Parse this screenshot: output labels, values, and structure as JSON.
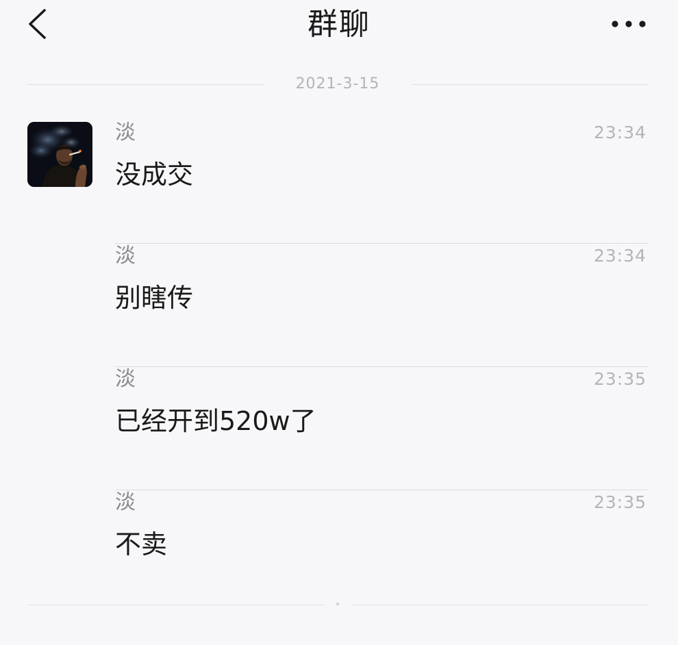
{
  "header": {
    "title": "群聊",
    "back_icon": "chevron-left-icon",
    "more_icon": "more-horizontal-icon"
  },
  "chat": {
    "date": "2021-3-15",
    "messages": [
      {
        "sender": "淡",
        "time": "23:34",
        "text": "没成交",
        "show_avatar": true
      },
      {
        "sender": "淡",
        "time": "23:34",
        "text": "别瞎传",
        "show_avatar": false
      },
      {
        "sender": "淡",
        "time": "23:35",
        "text": "已经开到520w了",
        "show_avatar": false
      },
      {
        "sender": "淡",
        "time": "23:35",
        "text": "不卖",
        "show_avatar": false
      }
    ]
  },
  "colors": {
    "background": "#f7f7f9",
    "text_primary": "#1a1a1a",
    "text_secondary": "#8a8a8e",
    "text_muted": "#b3b3b8",
    "divider": "#dcdce0"
  }
}
